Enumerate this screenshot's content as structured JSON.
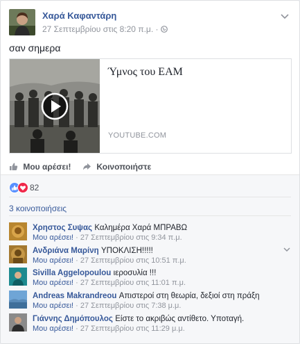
{
  "post": {
    "author": "Χαρά Καφαντάρη",
    "timestamp": "27 Σεπτεμβρίου στις 8:20 π.μ.",
    "separator": "·",
    "privacy_icon": "globe-icon",
    "text": "σαν σημερα"
  },
  "link_preview": {
    "title": "Ύμνος του ΕΑΜ",
    "domain": "YOUTUBE.COM"
  },
  "actions": {
    "like_label": "Μου αρέσει!",
    "share_label": "Κοινοποιήστε"
  },
  "reactions": {
    "count": "82",
    "types": [
      "like",
      "love"
    ]
  },
  "shares_label": "3 κοινοποιήσεις",
  "comments": [
    {
      "author": "Χρηστος Συψας",
      "text": "Καλημέρα Χαρά ΜΠΡΑΒΩ",
      "like_label": "Μου αρέσει!",
      "sep": "·",
      "time": "27 Σεπτεμβρίου στις 9:34 π.μ."
    },
    {
      "author": "Ανδριάνα Μαρίνη",
      "text": "ΥΠΟΚΛΙΣΗ!!!!!",
      "like_label": "Μου αρέσει!",
      "sep": "·",
      "time": "27 Σεπτεμβρίου στις 10:51 π.μ."
    },
    {
      "author": "Sivilla Aggelopoulou",
      "text": "ιεροσυλία !!!",
      "like_label": "Μου αρέσει!",
      "sep": "·",
      "time": "27 Σεπτεμβρίου στις 11:01 π.μ."
    },
    {
      "author": "Andreas Makrandreou",
      "text": "Απιστεροί στη θεωρία, δεξιοί στη πράξη",
      "like_label": "Μου αρέσει!",
      "sep": "·",
      "time": "27 Σεπτεμβρίου στις 7:38 μ.μ."
    },
    {
      "author": "Γιάννης Δημόπουλος",
      "text": "Είστε το ακριβώς αντίθετο. Υποταγή.",
      "like_label": "Μου αρέσει!",
      "sep": "·",
      "time": "27 Σεπτεμβρίου στις 11:29 μ.μ."
    }
  ],
  "colors": {
    "link_blue": "#365899",
    "meta_gray": "#90949c",
    "like_blue": "#5890ff",
    "love_red": "#f0284a"
  }
}
